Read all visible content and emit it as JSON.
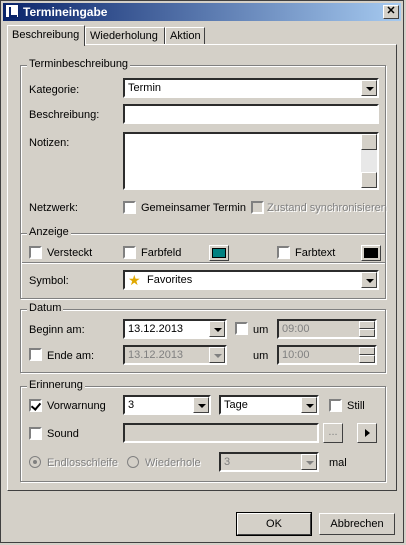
{
  "window": {
    "title": "Termineingabe",
    "close_label": "✕"
  },
  "tabs": [
    {
      "label": "Beschreibung"
    },
    {
      "label": "Wiederholung"
    },
    {
      "label": "Aktion"
    }
  ],
  "termin": {
    "legend": "Terminbeschreibung",
    "kategorie_label": "Kategorie:",
    "kategorie_value": "Termin",
    "beschreibung_label": "Beschreibung:",
    "beschreibung_value": "",
    "notizen_label": "Notizen:",
    "notizen_value": "",
    "netzwerk_label": "Netzwerk:",
    "gemeinsam_label": "Gemeinsamer Termin",
    "gemeinsam_checked": false,
    "zustand_label": "Zustand synchronisieren",
    "zustand_checked": false
  },
  "anzeige": {
    "legend": "Anzeige",
    "versteckt_label": "Versteckt",
    "farbfeld_label": "Farbfeld",
    "farbfeld_color": "#008080",
    "farbtext_label": "Farbtext",
    "farbtext_color": "#000000",
    "symbol_label": "Symbol:",
    "symbol_value": "Favorites",
    "symbol_icon": "star-icon"
  },
  "datum": {
    "legend": "Datum",
    "beginn_label": "Beginn am:",
    "beginn_value": "13.12.2013",
    "um_label": "um",
    "beginn_time": "09:00",
    "ende_label": "Ende am:",
    "ende_value": "13.12.2013",
    "ende_um_label": "um",
    "ende_time": "10:00"
  },
  "erinnerung": {
    "legend": "Erinnerung",
    "vorwarnung_label": "Vorwarnung",
    "vorwarnung_checked": true,
    "vorwarnung_value": "3",
    "unit_value": "Tage",
    "still_label": "Still",
    "sound_label": "Sound",
    "sound_value": "",
    "browse_label": "...",
    "endlos_label": "Endlosschleife",
    "wiederhole_label": "Wiederhole",
    "wiederhole_value": "3",
    "mal_label": "mal"
  },
  "footer": {
    "ok_label": "OK",
    "cancel_label": "Abbrechen"
  }
}
